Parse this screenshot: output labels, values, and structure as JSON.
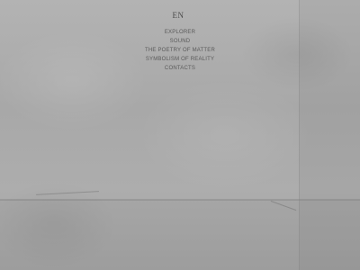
{
  "language": {
    "current": "EN"
  },
  "nav": {
    "items": [
      {
        "label": "EXPLORER"
      },
      {
        "label": "SOUND"
      },
      {
        "label": "THE POETRY OF MATTER"
      },
      {
        "label": "SYMBOLISM OF REALITY"
      },
      {
        "label": "CONTACTS"
      }
    ]
  },
  "colors": {
    "background": "#a9a9a9",
    "text": "#5a5a5a"
  }
}
